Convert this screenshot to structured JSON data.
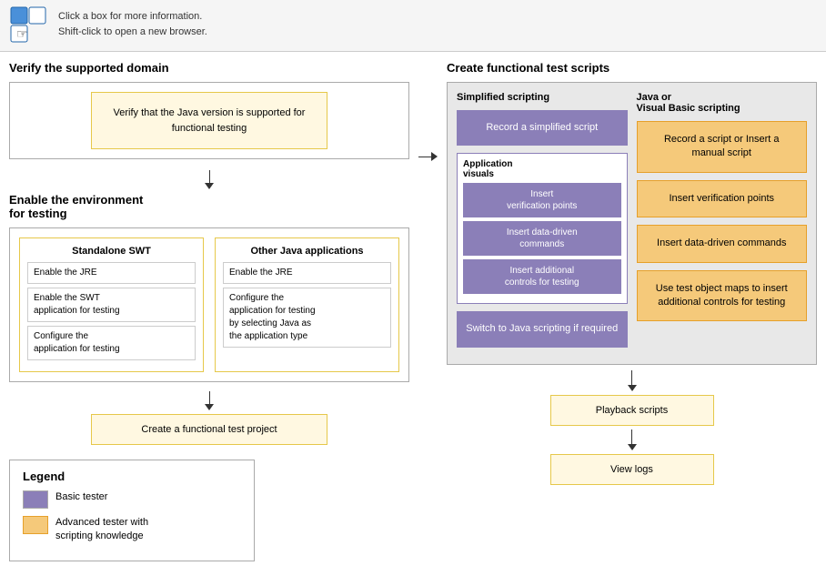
{
  "topbar": {
    "info_line1": "Click a box for more information.",
    "info_line2": "Shift-click to open a new browser."
  },
  "left": {
    "verify_section_title": "Verify the supported domain",
    "verify_box_text": "Verify that the Java version is\nsupported for functional testing",
    "enable_section_title_line1": "Enable the environment",
    "enable_section_title_line2": "for testing",
    "standalone_title": "Standalone SWT",
    "standalone_items": [
      "Enable the JRE",
      "Enable the SWT\napplication for testing",
      "Configure the\napplication for testing"
    ],
    "other_java_title": "Other Java applications",
    "other_java_items": [
      "Enable the JRE",
      "Configure the\napplication for testing\nby selecting Java as\nthe application type"
    ],
    "create_project_text": "Create a functional test project"
  },
  "legend": {
    "title": "Legend",
    "item1_text": "Basic tester",
    "item2_text": "Advanced tester with\nscripting knowledge"
  },
  "right": {
    "section_title": "Create functional test scripts",
    "simplified_col_title": "Simplified scripting",
    "java_col_title_line1": "Java or",
    "java_col_title_line2": "Visual Basic scripting",
    "record_simplified": "Record a\nsimplified script",
    "app_visuals_label": "Application\nvisuals",
    "insert_vp_simplified": "Insert\nverification points",
    "insert_ddc_simplified": "Insert data-driven\ncommands",
    "insert_controls_simplified": "Insert additional\ncontrols for testing",
    "switch_java": "Switch to Java scripting\nif required",
    "record_java": "Record a script or\nInsert a manual script",
    "insert_vp_java": "Insert\nverification points",
    "insert_ddc_java": "Insert data-driven\ncommands",
    "insert_controls_java": "Use test object maps\nto insert additional\ncontrols for testing",
    "playback_scripts": "Playback scripts",
    "view_logs": "View logs"
  }
}
